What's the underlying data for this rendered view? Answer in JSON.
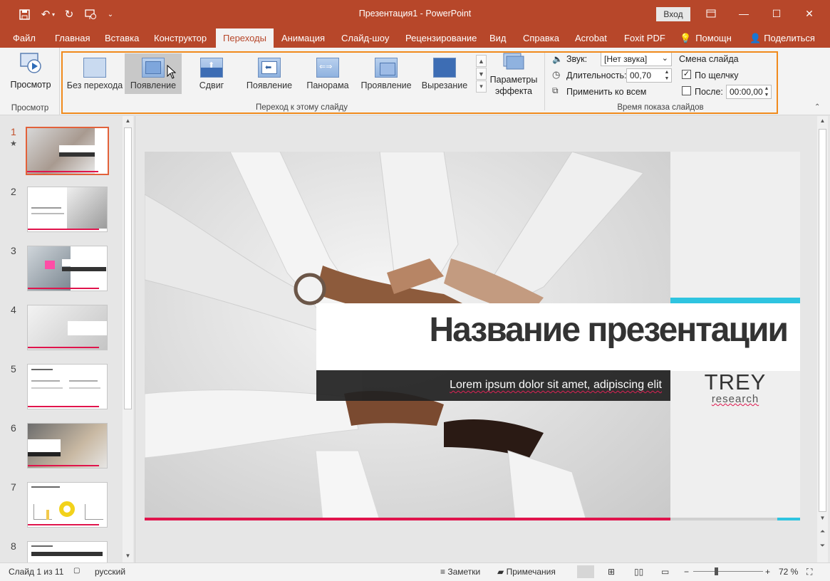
{
  "titlebar": {
    "title": "Презентация1  -  PowerPoint",
    "signin": "Вход",
    "bg_color": "#b7472a"
  },
  "tabs": [
    {
      "label": "Файл"
    },
    {
      "label": "Главная"
    },
    {
      "label": "Вставка"
    },
    {
      "label": "Конструктор"
    },
    {
      "label": "Переходы",
      "active": true
    },
    {
      "label": "Анимация"
    },
    {
      "label": "Слайд-шоу"
    },
    {
      "label": "Рецензирование"
    },
    {
      "label": "Вид"
    },
    {
      "label": "Справка"
    },
    {
      "label": "Acrobat"
    },
    {
      "label": "Foxit PDF"
    },
    {
      "label": "Помощн"
    },
    {
      "label": "Поделиться"
    }
  ],
  "ribbon": {
    "preview": {
      "label": "Просмотр",
      "group": "Просмотр"
    },
    "transitions": [
      {
        "label": "Без перехода",
        "icon": "none-transition-icon"
      },
      {
        "label": "Появление",
        "icon": "fade-transition-icon",
        "selected": true
      },
      {
        "label": "Сдвиг",
        "icon": "push-transition-icon"
      },
      {
        "label": "Появление",
        "icon": "wipe-transition-icon"
      },
      {
        "label": "Панорама",
        "icon": "pan-transition-icon"
      },
      {
        "label": "Проявление",
        "icon": "reveal-transition-icon"
      },
      {
        "label": "Вырезание",
        "icon": "cut-transition-icon"
      }
    ],
    "effect_params": "Параметры эффекта",
    "transition_group": "Переход к этому слайду",
    "sound_label": "Звук:",
    "sound_value": "[Нет звука]",
    "duration_label": "Длительность:",
    "duration_value": "00,70",
    "apply_all": "Применить ко всем",
    "advance_header": "Смена слайда",
    "on_click": "По щелчку",
    "on_click_checked": true,
    "after_label": "После:",
    "after_value": "00:00,00",
    "after_checked": false,
    "timing_group": "Время показа слайдов"
  },
  "thumbnails": [
    {
      "num": "1",
      "active": true,
      "star": "★"
    },
    {
      "num": "2"
    },
    {
      "num": "3"
    },
    {
      "num": "4"
    },
    {
      "num": "5"
    },
    {
      "num": "6"
    },
    {
      "num": "7"
    },
    {
      "num": "8"
    }
  ],
  "slide": {
    "title": "Название презентации",
    "subtitle": "Lorem ipsum dolor sit amet, adipiscing elit",
    "logo_main": "TREY",
    "logo_sub": "research",
    "accent_color": "#2fc4e0",
    "bar_color": "#e0144c"
  },
  "status": {
    "slide_info": "Слайд 1 из 11",
    "language": "русский",
    "notes": "Заметки",
    "comments": "Примечания",
    "zoom": "72 %"
  }
}
